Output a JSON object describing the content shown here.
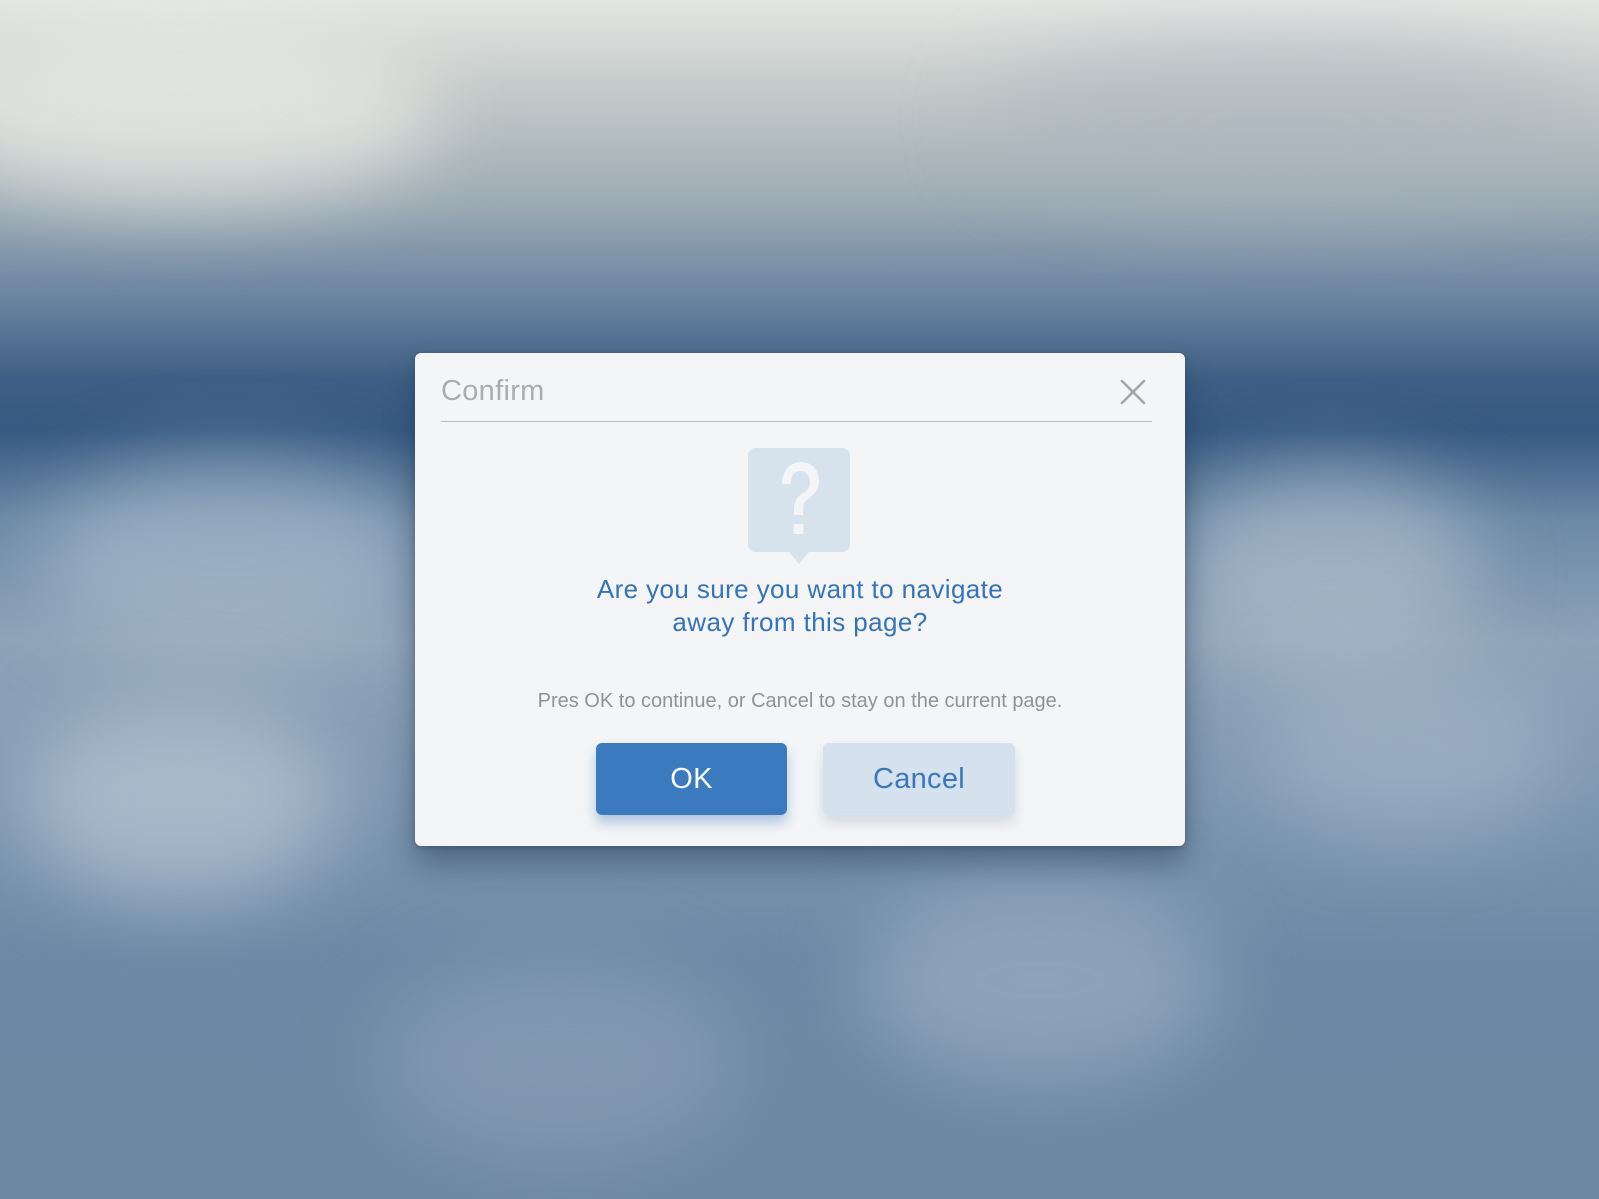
{
  "dialog": {
    "title": "Confirm",
    "close_icon": "close-icon",
    "icon": "question-speech-bubble-icon",
    "headline_line1": "Are you sure you want to navigate",
    "headline_line2": "away from this page?",
    "message": "Pres OK to continue, or Cancel to stay on the current page.",
    "ok_label": "OK",
    "cancel_label": "Cancel"
  },
  "colors": {
    "accent": "#3a7bc0",
    "headline": "#3673b8",
    "cancel_bg": "#d5e1ec",
    "dialog_bg": "#f3f5f7",
    "icon_fill": "#d6e2ec"
  }
}
